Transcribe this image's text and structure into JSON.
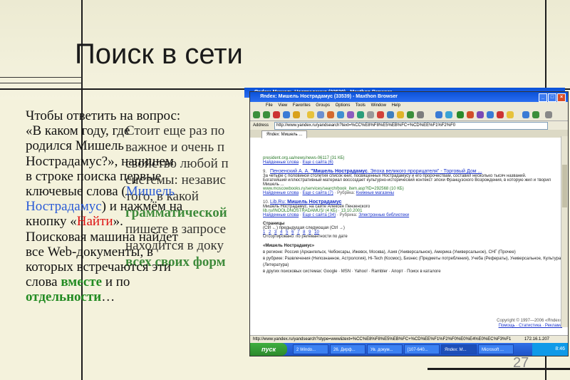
{
  "slide": {
    "title": "Поиск в сети",
    "number": "27",
    "left_text": {
      "line1": "Чтобы ответить на вопрос:",
      "line2": "«В каком году, где",
      "line3": "родился Мишель",
      "line4": "Нострадамус?», напишем",
      "line5": "в строке поиска первые",
      "line6_a": "ключевые слова (",
      "line6_b": "Мишель",
      "line7_a": "Нострадамус",
      "line7_b": ") и нажмём на",
      "line8_a": "кнопку «",
      "line8_b": "Найти",
      "line8_c": "».",
      "line9": "Поисковая машина найдет",
      "line10": "все Web-документы, в",
      "line11": "которых встречаются эти",
      "line12_a": "слова ",
      "line12_b": "вместе",
      "line12_c": " и по",
      "line13_a": "отдельности",
      "line13_b": "…"
    },
    "overlay_text": {
      "l1": "Стоит еще раз по",
      "l2": "важное и очень п",
      "l3": "свойство любой п",
      "l4": "системы: независ",
      "l5": "того, в какой",
      "l6": "грамматической",
      "l7": "пишете в запросе",
      "l8": "находится в доку",
      "l9": "всех своих форм"
    }
  },
  "browser": {
    "behind_title": "Яndex: Мишель Нострадамус (33539) - Maxthon Browser",
    "title": "Яndex: Мишель Нострадамус (33539) - Maxthon Browser",
    "menu": [
      "File",
      "View",
      "Favorites",
      "Groups",
      "Options",
      "Tools",
      "Window",
      "Help"
    ],
    "address_label": "Address",
    "address": "http://www.yandex.ru/yandsearch?text=%CC%E8%F8%E5%EB%FC+%CD%EE%F1%F2%F0",
    "tab": "Яndex: Мишель ...",
    "results": [
      {
        "url": "president.org.ua/news/news-06117 (31 КБ)",
        "found": "Найденные слова",
        "more": "Еще с сайта (6)"
      },
      {
        "num": "9.",
        "title_a": "Пензенский А. А. ",
        "title_b": "\"Мишель Нострадамус",
        "title_c": ". Эпоха великого прорицателя\" - Торговый Дом ...",
        "snippet": "За четыре с половиной столетия список книг, посвященных Нострадамусу и его пророчествам, составил несколько тысяч названий.",
        "snippet2": "Богатейший иллюстративный материал воссоздает культурно-исторический контекст эпохи Французского Возрождения, в которую жил и творил Мишель ...",
        "url": "www.moscowbooks.ru/services/search/book_item.asp?ID=292568 (10 КБ)",
        "found": "Найденные слова",
        "more": "Еще с сайта (7)",
        "rubric_label": "Рубрика:",
        "rubric": "Книжные магазины"
      },
      {
        "num": "10.",
        "title_a": "Lib.Ru: ",
        "title_b": "Мишель Нострадамус",
        "snippet": "Мишель Нострадамус. на сайте Алексея Пензенского",
        "url": "lib.ru/INOOLDNOSTRADAMUS/ (4 КБ) · 13.10.2001",
        "found": "Найденные слова",
        "more": "Еще с сайта (34)",
        "rubric_label": "Рубрика:",
        "rubric": "Электронные библиотеки"
      }
    ],
    "pages_label": "Страницы",
    "pages_nav": "(Ctrl ←) предыдущая  следующая (Ctrl →)",
    "pages": [
      "1",
      "2",
      "3",
      "4",
      "5",
      "6",
      "7",
      "8",
      "9",
      "10"
    ],
    "sorted": "Отсортировано: по релевантности  по дате",
    "related_title": "«Мишель Нострадамус»",
    "related_regions": "в регионе: Россия (Архангельск, Чебоксары, Ижевск, Москва), Азия (Универсальное), Америка (Универсальное), СНГ (Прочее)",
    "related_rubric": "в рубрике: Развлечения (Непознанное, Астрология), Hi-Tech (Космос), Бизнес (Предметы потребления), Учеба (Рефераты), Универсальное, Культура (Литература)",
    "related_other": "в других поисковых системах: Google · MSN · Yahoo! · Rambler · Апорт · Поиск в каталоге",
    "copyright": "Copyright © 1997—2006 «Яndex»",
    "copyright_links": "Помощь · Статистика · Реклама",
    "status_url": "http://www.yandex.ru/yandsearch?stype=www&text=%CC%E8%F8%E5%EB%FC+%CD%EE%F1%F2%F0%E0%E4%E0%EC%F3%F1",
    "status_ip": "172.16.1.207",
    "start": "пуск",
    "taskbar_items": [
      "2 Windo...",
      "26. Дирф...",
      "Ув. докум...",
      "[107-640...",
      "Яndex: М...",
      "Microsoft ..."
    ],
    "clock": "8:46"
  }
}
